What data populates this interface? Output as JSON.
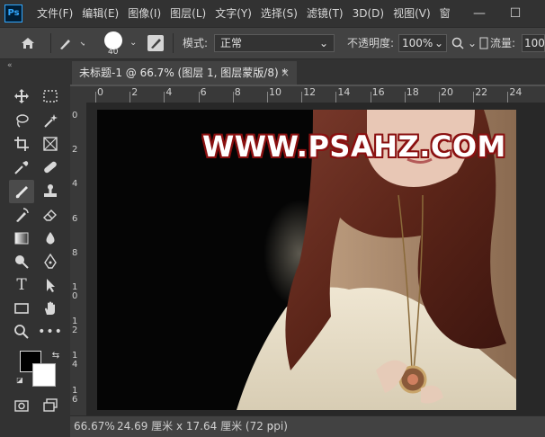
{
  "app": {
    "logo_text": "Ps"
  },
  "menu": [
    "文件(F)",
    "编辑(E)",
    "图像(I)",
    "图层(L)",
    "文字(Y)",
    "选择(S)",
    "滤镜(T)",
    "3D(D)",
    "视图(V)",
    "窗"
  ],
  "window_controls": {
    "minimize": "—",
    "maximize": "☐"
  },
  "options": {
    "brush_size": "40",
    "mode_label": "模式:",
    "mode_value": "正常",
    "opacity_label": "不透明度:",
    "opacity_value": "100%",
    "flow_label": "流量:",
    "flow_value": "100"
  },
  "tab": {
    "title": "未标题-1 @ 66.7% (图层 1, 图层蒙版/8) *",
    "close": "×"
  },
  "ruler_top": [
    "0",
    "2",
    "4",
    "6",
    "8",
    "10",
    "12",
    "14",
    "16",
    "18",
    "20",
    "22",
    "24"
  ],
  "ruler_left": [
    "0",
    "2",
    "4",
    "6",
    "8",
    "1\n0",
    "1\n2",
    "1\n4",
    "1\n6"
  ],
  "watermark": "WWW.PSAHZ.COM",
  "status": {
    "zoom": "66.67%",
    "doc_info": "24.69 厘米 x 17.64 厘米 (72 ppi)",
    "arrow": "›"
  },
  "colors": {
    "foreground": "#000000",
    "background": "#ffffff",
    "accent": "#31a8ff"
  },
  "tools": [
    "move-tool",
    "marquee-tool",
    "lasso-tool",
    "magic-wand-tool",
    "crop-tool",
    "frame-tool",
    "eyedropper-tool",
    "healing-brush-tool",
    "brush-tool",
    "clone-stamp-tool",
    "history-brush-tool",
    "eraser-tool",
    "gradient-tool",
    "blur-tool",
    "dodge-tool",
    "pen-tool",
    "type-tool",
    "path-selection-tool",
    "rectangle-tool",
    "hand-tool",
    "zoom-tool",
    "more-tools"
  ]
}
